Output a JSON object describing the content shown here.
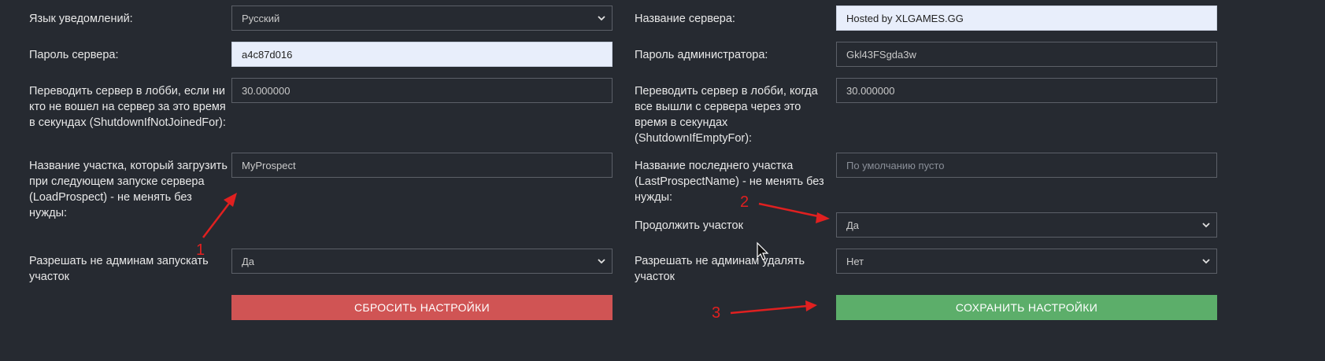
{
  "left": {
    "notify_lang": {
      "label": "Язык уведомлений:",
      "value": "Русский"
    },
    "server_password": {
      "label": "Пароль сервера:",
      "value": "a4c87d016"
    },
    "shutdown_not_joined": {
      "label_lines": [
        "Переводить сервер в лобби, если ни",
        "кто не вошел на сервер за это время",
        "в секундах (ShutdownIfNotJoinedFor):"
      ],
      "value": "30.000000"
    },
    "load_prospect": {
      "label_lines": [
        "Название участка, который загрузить",
        "при следующем запуске сервера",
        "(LoadProspect) - не менять без",
        "нужды:"
      ],
      "value": "MyProspect"
    },
    "allow_nonadmin_start": {
      "label_lines": [
        "Разрешать не админам запускать",
        "участок"
      ],
      "value": "Да"
    },
    "reset_button": "СБРОСИТЬ НАСТРОЙКИ"
  },
  "right": {
    "server_name": {
      "label": "Название сервера:",
      "value": "Hosted by XLGAMES.GG"
    },
    "admin_password": {
      "label": "Пароль администратора:",
      "value": "Gkl43FSgda3w"
    },
    "shutdown_empty": {
      "label_lines": [
        "Переводить сервер в лобби, когда",
        "все вышли с сервера через это",
        "время в секундах",
        "(ShutdownIfEmptyFor):"
      ],
      "value": "30.000000"
    },
    "last_prospect": {
      "label_lines": [
        "Название последнего участка",
        "(LastProspectName) - не менять без",
        "нужды:"
      ],
      "placeholder": "По умолчанию пусто"
    },
    "continue_prospect": {
      "label": "Продолжить участок",
      "value": "Да"
    },
    "allow_nonadmin_delete": {
      "label_lines": [
        "Разрешать не админам удалять",
        "участок"
      ],
      "value": "Нет"
    },
    "save_button": "СОХРАНИТЬ НАСТРОЙКИ"
  },
  "annotations": {
    "one": "1",
    "two": "2",
    "three": "3"
  },
  "colors": {
    "background": "#262a31",
    "reset": "#d05454",
    "save": "#5cae6a",
    "arrow": "#e02020"
  }
}
